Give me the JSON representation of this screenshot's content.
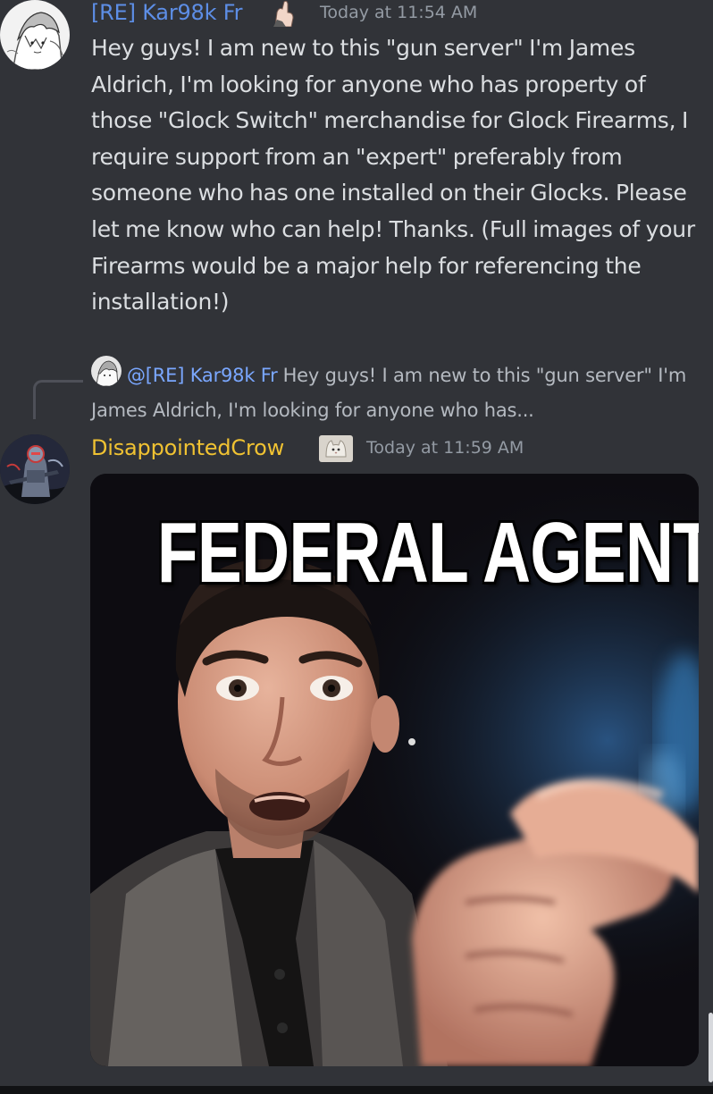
{
  "messages": [
    {
      "username": "[RE] Kar98k Fr",
      "username_color": "#5d8ee6",
      "avatar_icon": "anime-sketch-avatar",
      "role_icon": "pointing-hand-icon",
      "timestamp": "Today at 11:54 AM",
      "text": "Hey guys! I am new to this \"gun server\" I'm James Aldrich, I'm looking for anyone who has property of those \"Glock Switch\" merchandise for Glock Firearms, I require support from an \"expert\" preferably from someone who has one installed on their Glocks. Please let me know who can help! Thanks. (Full images of your Firearms would be a major help for referencing the installation!)"
    },
    {
      "reply_to": {
        "mention": "@[RE] Kar98k Fr",
        "mention_color": "#7aa7ff",
        "preview": "Hey guys! I am new to this \"gun server\" I'm James Aldrich, I'm looking for anyone who has..."
      },
      "username": "DisappointedCrow",
      "username_color": "#f0c232",
      "avatar_icon": "armored-character-avatar",
      "role_icon": "cat-icon",
      "timestamp": "Today at 11:59 AM",
      "attachment": {
        "type": "image",
        "caption": "FEDERAL AGENT"
      }
    }
  ],
  "colors": {
    "background": "#313338",
    "text": "#dbdee1",
    "muted": "#949ba4"
  }
}
